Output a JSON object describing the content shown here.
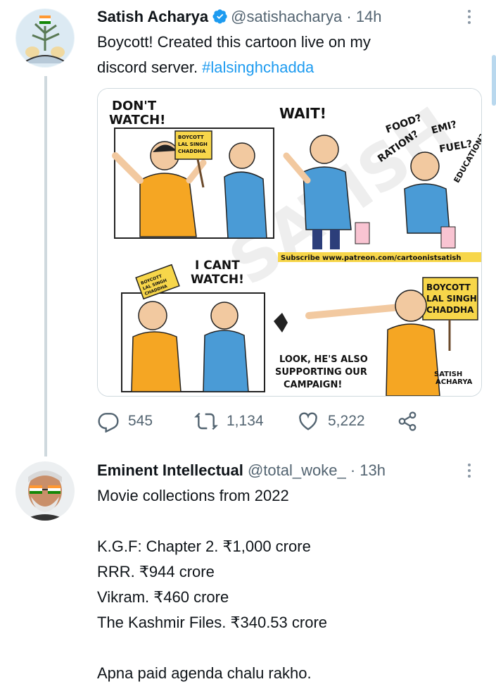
{
  "tweets": [
    {
      "name": "Satish Acharya",
      "handle": "@satishacharya",
      "separator": "·",
      "time": "14h",
      "text_main": "Boycott! Created this cartoon live on my\ndiscord server. ",
      "hashtag": "#lalsinghchadda",
      "replies": "545",
      "retweets": "1,134",
      "likes": "5,222",
      "cartoon": {
        "p1_speech": "DON'T\nWATCH!",
        "p1_sign": "BOYCOTT\nLAL SINGH\nCHADDHA",
        "p2_speech": "WAIT!",
        "p3_words": [
          "FOOD?",
          "RATION?",
          "EMI?",
          "FUEL?",
          "EDUCATION?"
        ],
        "subscribe": "Subscribe www.patreon.com/cartoonistsatish",
        "p4_speech": "I CANT\nWATCH!",
        "p4_sign": "BOYCOTT\nLAL SINGH\nCHADDHA",
        "p5_sign": "BOYCOTT\nLAL SINGH\nCHADDHA",
        "p5_speech": "LOOK, HE'S ALSO\nSUPPORTING OUR\nCAMPAIGN!",
        "signature": "SATISH\nACHARYA",
        "watermark": "SATISH"
      }
    },
    {
      "name": "Eminent Intellectual",
      "handle": "@total_woke_",
      "separator": "·",
      "time": "13h",
      "text": "Movie collections from 2022\n\nK.G.F: Chapter 2. ₹1,000 crore\nRRR. ₹944 crore\nVikram. ₹460 crore\nThe Kashmir Files. ₹340.53 crore\n\nApna paid agenda chalu rakho."
    }
  ],
  "colors": {
    "accent": "#1d9bf0",
    "secondary_text": "#536471",
    "shirt_orange": "#f5a623",
    "shirt_blue": "#4a9bd6"
  }
}
